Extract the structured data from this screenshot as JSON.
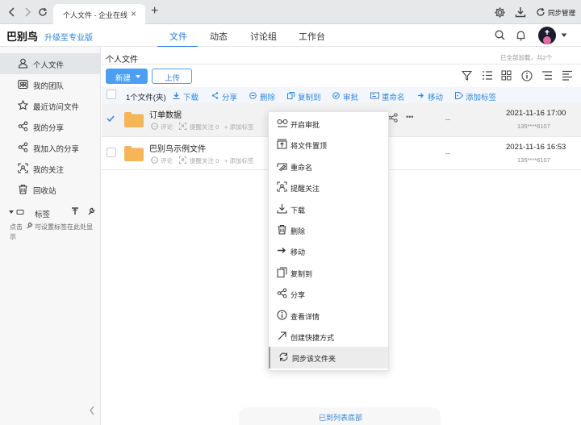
{
  "browser": {
    "tab_title": "个人文件 - 企业在线...",
    "close": "×",
    "new_tab": "+",
    "sync_label": "同步管理"
  },
  "app": {
    "brand": "巴别鸟",
    "upgrade": "升级至专业版",
    "nav_tabs": [
      "文件",
      "动态",
      "讨论组",
      "工作台"
    ]
  },
  "sidebar": {
    "items": [
      "个人文件",
      "我的团队",
      "最近访问文件",
      "我的分享",
      "我加入的分享",
      "我的关注",
      "回收站"
    ],
    "tags_title": "标签",
    "tags_hint_line1": "点击",
    "tags_hint_line1b": "可设置标签在此处显",
    "tags_hint_line2": "示"
  },
  "main": {
    "breadcrumb": "个人文件",
    "load_status": "已全部加载，共2个",
    "new_button": "新建",
    "upload_button": "上传",
    "selection_count": "1个文件(夹)",
    "actions": [
      "下载",
      "分享",
      "删除",
      "复制到",
      "审批",
      "重命名",
      "移动",
      "添加标签"
    ],
    "bottom_status": "已到列表底部"
  },
  "files": [
    {
      "name": "订单数据",
      "meta": [
        "评论",
        "提醒关注 0",
        "+ 添加标签"
      ],
      "size": "--",
      "date": "2021-11-16 17:00",
      "owner": "135****6107",
      "selected": true
    },
    {
      "name": "巴别鸟示例文件",
      "meta": [
        "评论",
        "提醒关注 0",
        "+ 添加标签"
      ],
      "size": "--",
      "date": "2021-11-16 16:53",
      "owner": "135****6107",
      "selected": false
    }
  ],
  "more_dots": "•••",
  "context_menu": {
    "items": [
      "开启审批",
      "将文件置顶",
      "重命名",
      "提醒关注",
      "下载",
      "删除",
      "移动",
      "复制到",
      "分享",
      "查看详情",
      "创建快捷方式",
      "同步该文件夹"
    ],
    "hovered_index": 11
  },
  "colors": {
    "accent": "#1f7de0",
    "link": "#2e86de",
    "new_button": "#4a9ff5",
    "folder": "#f6b556"
  }
}
